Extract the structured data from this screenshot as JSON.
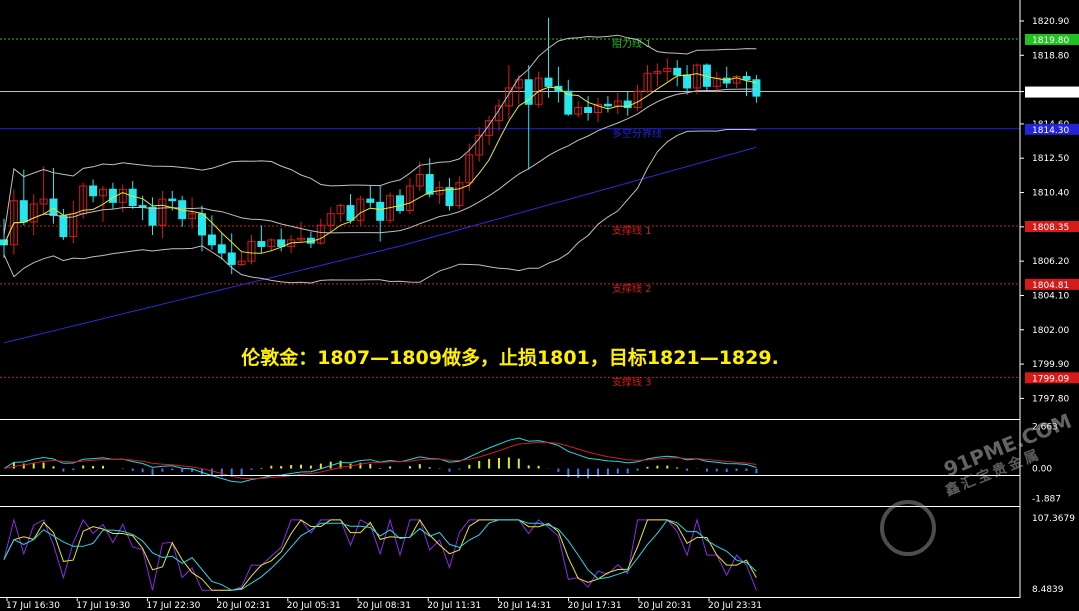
{
  "headline": "伦敦金：1807—1809做多，止损1801，目标1821—1829.",
  "watermark": {
    "main": "91PME.COM",
    "sub": "鑫汇宝贵金属"
  },
  "colors": {
    "bull_candle": "#d21c1c",
    "bear_candle": "#27e6ec",
    "resistance": "#22c022",
    "support": "#d51a1a",
    "pivot": "#2323d8",
    "ma_long": "#2c2cdb",
    "bollinger": "#bfbfbf",
    "ma_short": "#e6e62a",
    "macd_fast": "#27d4e6",
    "macd_slow": "#cc1f1f",
    "macd_pos": "#e6e62a",
    "macd_neg": "#3d7ce6",
    "osc_a": "#8a2be6",
    "osc_b": "#e6e62a",
    "osc_c": "#27d4e6"
  },
  "chart_data": {
    "type": "candlestick",
    "price_axis": {
      "ylim": [
        1796.6,
        1822.0
      ],
      "ticks": [
        "1820.90",
        "1818.80",
        "1816.58",
        "1814.60",
        "1812.50",
        "1810.40",
        "1808.30",
        "1806.20",
        "1804.10",
        "1802.00",
        "1799.90",
        "1797.80"
      ],
      "current_price": "1816.58"
    },
    "levels": [
      {
        "name": "阻力线 1",
        "value": 1819.8,
        "label": "1819.80",
        "kind": "resistance"
      },
      {
        "name": "多空分界线",
        "value": 1814.3,
        "label": "1814.30",
        "kind": "pivot"
      },
      {
        "name": "支撑线 1",
        "value": 1808.35,
        "label": "1808.35",
        "kind": "support"
      },
      {
        "name": "支撑线 2",
        "value": 1804.81,
        "label": "1804.81",
        "kind": "support"
      },
      {
        "name": "支撑线 3",
        "value": 1799.09,
        "label": "1799.09",
        "kind": "support"
      }
    ],
    "time_labels": [
      "17 Jul 16:30",
      "17 Jul 19:30",
      "17 Jul 22:30",
      "20 Jul 02:31",
      "20 Jul 05:31",
      "20 Jul 08:31",
      "20 Jul 11:31",
      "20 Jul 14:31",
      "20 Jul 17:31",
      "20 Jul 20:31",
      "20 Jul 23:31"
    ],
    "candles": [
      [
        1807.5,
        1808.8,
        1806.4,
        1807.2
      ],
      [
        1807.2,
        1810.6,
        1806.6,
        1809.9
      ],
      [
        1809.9,
        1811.8,
        1808.4,
        1808.6
      ],
      [
        1808.6,
        1810.3,
        1807.8,
        1809.7
      ],
      [
        1809.7,
        1812.0,
        1809.0,
        1810.0
      ],
      [
        1810.0,
        1811.9,
        1808.5,
        1809.0
      ],
      [
        1809.0,
        1809.4,
        1807.5,
        1807.7
      ],
      [
        1807.7,
        1809.9,
        1807.3,
        1809.1
      ],
      [
        1809.1,
        1811.0,
        1808.8,
        1810.8
      ],
      [
        1810.8,
        1811.2,
        1809.8,
        1810.2
      ],
      [
        1810.2,
        1810.8,
        1808.6,
        1810.6
      ],
      [
        1810.6,
        1811.0,
        1809.4,
        1809.8
      ],
      [
        1809.8,
        1810.9,
        1809.2,
        1810.6
      ],
      [
        1810.6,
        1811.1,
        1809.4,
        1809.6
      ],
      [
        1809.6,
        1810.2,
        1808.7,
        1809.5
      ],
      [
        1809.5,
        1810.1,
        1807.8,
        1808.4
      ],
      [
        1808.4,
        1810.5,
        1807.6,
        1810.0
      ],
      [
        1810.0,
        1810.5,
        1809.3,
        1809.9
      ],
      [
        1809.9,
        1810.2,
        1808.3,
        1808.8
      ],
      [
        1808.8,
        1810.1,
        1808.2,
        1809.1
      ],
      [
        1809.1,
        1809.6,
        1806.8,
        1807.8
      ],
      [
        1807.8,
        1809.0,
        1806.9,
        1807.2
      ],
      [
        1807.2,
        1807.9,
        1806.3,
        1806.7
      ],
      [
        1806.7,
        1807.9,
        1805.4,
        1806.0
      ],
      [
        1806.0,
        1806.8,
        1805.9,
        1806.2
      ],
      [
        1806.2,
        1807.8,
        1806.0,
        1807.4
      ],
      [
        1807.4,
        1808.4,
        1806.7,
        1807.1
      ],
      [
        1807.1,
        1807.6,
        1806.8,
        1807.5
      ],
      [
        1807.5,
        1808.2,
        1806.8,
        1807.1
      ],
      [
        1807.1,
        1807.8,
        1806.7,
        1807.5
      ],
      [
        1807.5,
        1808.6,
        1807.4,
        1807.6
      ],
      [
        1807.6,
        1808.0,
        1807.0,
        1807.3
      ],
      [
        1807.3,
        1808.8,
        1807.2,
        1808.4
      ],
      [
        1808.4,
        1809.5,
        1808.0,
        1809.1
      ],
      [
        1809.1,
        1809.7,
        1808.6,
        1809.6
      ],
      [
        1809.6,
        1810.3,
        1808.5,
        1808.7
      ],
      [
        1808.7,
        1810.2,
        1808.4,
        1810.0
      ],
      [
        1810.0,
        1810.8,
        1809.5,
        1809.8
      ],
      [
        1809.8,
        1810.8,
        1807.4,
        1808.7
      ],
      [
        1808.7,
        1810.4,
        1808.5,
        1810.2
      ],
      [
        1810.2,
        1810.6,
        1809.1,
        1809.3
      ],
      [
        1809.3,
        1811.3,
        1809.1,
        1810.8
      ],
      [
        1810.8,
        1812.3,
        1810.5,
        1811.5
      ],
      [
        1811.5,
        1812.5,
        1810.1,
        1810.3
      ],
      [
        1810.3,
        1811.1,
        1809.7,
        1810.7
      ],
      [
        1810.7,
        1811.3,
        1809.3,
        1809.6
      ],
      [
        1809.6,
        1811.4,
        1809.4,
        1811.0
      ],
      [
        1811.0,
        1813.4,
        1810.5,
        1812.7
      ],
      [
        1812.7,
        1814.4,
        1812.3,
        1813.9
      ],
      [
        1813.9,
        1815.1,
        1813.3,
        1814.8
      ],
      [
        1814.8,
        1816.1,
        1814.2,
        1815.7
      ],
      [
        1815.7,
        1818.2,
        1814.9,
        1816.8
      ],
      [
        1816.8,
        1817.6,
        1815.8,
        1817.3
      ],
      [
        1817.3,
        1818.2,
        1811.8,
        1815.8
      ],
      [
        1815.8,
        1817.8,
        1815.6,
        1817.4
      ],
      [
        1817.4,
        1821.1,
        1816.2,
        1816.9
      ],
      [
        1816.9,
        1818.1,
        1815.9,
        1816.6
      ],
      [
        1816.6,
        1817.3,
        1815.1,
        1815.2
      ],
      [
        1815.2,
        1816.0,
        1815.0,
        1815.6
      ],
      [
        1815.6,
        1816.3,
        1814.8,
        1815.3
      ],
      [
        1815.3,
        1816.2,
        1814.7,
        1815.8
      ],
      [
        1815.8,
        1816.3,
        1815.3,
        1815.7
      ],
      [
        1815.7,
        1816.5,
        1815.2,
        1816.0
      ],
      [
        1816.0,
        1816.6,
        1815.1,
        1815.6
      ],
      [
        1815.6,
        1817.0,
        1815.4,
        1816.6
      ],
      [
        1816.6,
        1818.2,
        1816.5,
        1817.7
      ],
      [
        1817.7,
        1818.3,
        1816.9,
        1817.8
      ],
      [
        1817.8,
        1818.6,
        1817.2,
        1818.0
      ],
      [
        1818.0,
        1818.5,
        1816.9,
        1817.6
      ],
      [
        1817.6,
        1818.2,
        1816.4,
        1816.8
      ],
      [
        1816.8,
        1818.3,
        1816.4,
        1818.2
      ],
      [
        1818.2,
        1818.3,
        1816.6,
        1816.9
      ],
      [
        1816.9,
        1817.8,
        1816.5,
        1817.4
      ],
      [
        1817.4,
        1818.1,
        1816.8,
        1817.1
      ],
      [
        1817.1,
        1817.6,
        1816.8,
        1817.5
      ],
      [
        1817.5,
        1817.8,
        1816.3,
        1817.3
      ],
      [
        1817.3,
        1817.6,
        1815.9,
        1816.3
      ]
    ],
    "indicators": {
      "macd_ticks": [
        "2.663",
        "0.00",
        "-1.887"
      ],
      "macd_range": [
        -2.3,
        3.0
      ],
      "osc_ticks": [
        "107.3679",
        "8.4839"
      ],
      "osc_range": [
        8.4839,
        107.3679
      ]
    }
  }
}
